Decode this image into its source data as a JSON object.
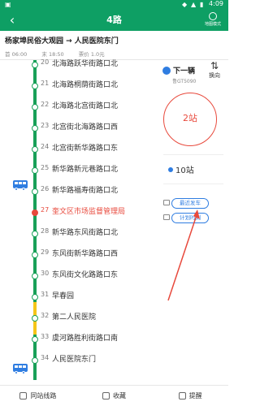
{
  "statusbar": {
    "time": "4:09"
  },
  "appbar": {
    "title": "4路",
    "mode_label": "地图模式"
  },
  "route": {
    "direction": "杨家埠民俗大观园 → 人民医院东门",
    "first_bus": "首 06:00",
    "last_bus": "末 18:50",
    "price": "票价 1.0元"
  },
  "stops": [
    {
      "num": "20",
      "name": "北海路跃华街路口北"
    },
    {
      "num": "21",
      "name": "北海路桐荫街路口北"
    },
    {
      "num": "22",
      "name": "北海路北宫街路口北"
    },
    {
      "num": "23",
      "name": "北宫街北海路路口西"
    },
    {
      "num": "24",
      "name": "北宫街新华路路口东"
    },
    {
      "num": "25",
      "name": "新华路新元巷路口北"
    },
    {
      "num": "26",
      "name": "新华路福寿街路口北"
    },
    {
      "num": "27",
      "name": "奎文区市场监督管理局"
    },
    {
      "num": "28",
      "name": "新华路东风街路口北"
    },
    {
      "num": "29",
      "name": "东风街新华路路口西"
    },
    {
      "num": "30",
      "name": "东风街文化路路口东"
    },
    {
      "num": "31",
      "name": "早春园"
    },
    {
      "num": "32",
      "name": "第二人民医院"
    },
    {
      "num": "33",
      "name": "虞河路胜利街路口南"
    },
    {
      "num": "34",
      "name": "人民医院东门"
    }
  ],
  "panel": {
    "switch_label": "换向",
    "next_bus_label": "下一辆",
    "plate": "鲁GT5090",
    "stations_away": "2站",
    "more_label": "10站",
    "recent_departure_label": "最近发车",
    "schedule_label": "计划时刻"
  },
  "bottom": {
    "tab1": "同站线路",
    "tab2": "收藏",
    "tab3": "提醒"
  },
  "colors": {
    "brand_green": "#0e9f64",
    "line_green": "#18a058",
    "line_yellow": "#f5c518",
    "current_red": "#e8493c",
    "accent_blue": "#2f7de1"
  }
}
